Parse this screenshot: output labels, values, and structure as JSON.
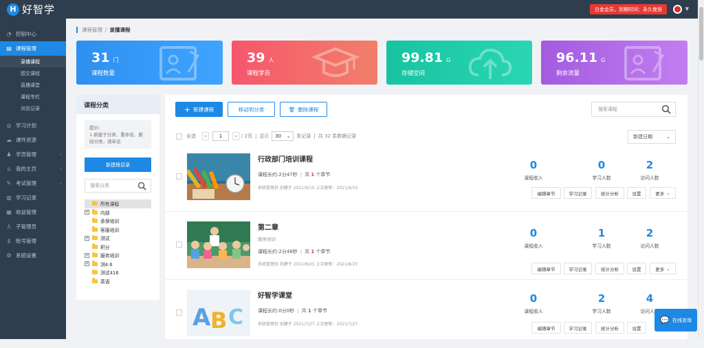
{
  "app": {
    "logo_letter": "H",
    "name": "好智学"
  },
  "topbar": {
    "membership": "白金会员，到期时间：永久使用"
  },
  "sidebar": {
    "items": [
      {
        "label": "控制中心",
        "icon": "dashboard-icon"
      },
      {
        "label": "课程管理",
        "icon": "course-icon",
        "active": true
      },
      {
        "label": "学习计划",
        "icon": "plan-icon"
      },
      {
        "label": "课件资源",
        "icon": "resource-icon"
      },
      {
        "label": "学员管理",
        "icon": "student-icon"
      },
      {
        "label": "我的主页",
        "icon": "home-icon"
      },
      {
        "label": "考试管理",
        "icon": "exam-icon"
      },
      {
        "label": "学习记录",
        "icon": "record-icon"
      },
      {
        "label": "收益管理",
        "icon": "income-icon"
      },
      {
        "label": "子管理员",
        "icon": "admin-icon"
      },
      {
        "label": "账号管理",
        "icon": "account-icon"
      },
      {
        "label": "系统设置",
        "icon": "settings-icon"
      }
    ],
    "sub_items": [
      "录播课程",
      "图文课程",
      "直播课堂",
      "课程专栏",
      "浏览记录"
    ]
  },
  "breadcrumb": {
    "parent": "课程管理",
    "separator": "/",
    "current": "录播课程"
  },
  "stats": [
    {
      "value": "31",
      "unit": "门",
      "label": "课程数量",
      "color": "#2196f3"
    },
    {
      "value": "39",
      "unit": "人",
      "label": "课程学员",
      "color": "#f5576c"
    },
    {
      "value": "99.81",
      "unit": "G",
      "label": "存储空间",
      "color": "#1ec8a5"
    },
    {
      "value": "96.11",
      "unit": "G",
      "label": "剩余流量",
      "color": "#b067e0"
    }
  ],
  "category": {
    "title": "课程分类",
    "tips_title": "提示：",
    "tips_body": "1.新建子分类、重命名、删除分类，请单击",
    "new_button": "新建根目录",
    "search_placeholder": "搜索分类",
    "tree": [
      {
        "label": "所有课程",
        "selected": true
      },
      {
        "label": "内部",
        "expandable": true
      },
      {
        "label": "承保培训"
      },
      {
        "label": "客服培训"
      },
      {
        "label": "测试",
        "expandable": true
      },
      {
        "label": "积分"
      },
      {
        "label": "服务培训",
        "expandable": true
      },
      {
        "label": "测4.6",
        "expandable": true
      },
      {
        "label": "测试416"
      },
      {
        "label": "英语"
      }
    ]
  },
  "toolbar": {
    "new_course": "新建课程",
    "move_category": "移动到分类",
    "delete_course": "删除课程",
    "search_placeholder": "搜索课程"
  },
  "pager": {
    "select_all": "全选",
    "page": "1",
    "total_pages": "/ 2页",
    "show": "显示",
    "page_size": "30",
    "per_page": "条记录",
    "separator": "|",
    "total": "共 32 条数据记录",
    "prev": "<",
    "next": ">",
    "sort": "新建日期"
  },
  "labels": {
    "duration": "课程长约:",
    "total_prefix": "共",
    "chapters_suffix": "个章节",
    "income": "课程收入",
    "learners": "学习人数",
    "visitors": "访问人数",
    "edit": "编辑章节",
    "records": "学习记录",
    "analysis": "统计分析",
    "settings": "设置",
    "more": "更多"
  },
  "courses": [
    {
      "title": "行政部门培训课程",
      "subtitle": "",
      "duration": "2分47秒",
      "chapters": "1",
      "info": "系统管理员 创建于 2021/9/10 上次更新：2021/9/10",
      "income": "0",
      "learners": "0",
      "visitors": "2",
      "thumb_icon": "classroom-pencils-image"
    },
    {
      "title": "第二章",
      "subtitle": "服务培训",
      "duration": "2分48秒",
      "chapters": "1",
      "info": "系统管理员 创建于 2021/8/25 上次更新：2021/8/25",
      "income": "0",
      "learners": "1",
      "visitors": "2",
      "thumb_icon": "classroom-kids-image"
    },
    {
      "title": "好智学课堂",
      "subtitle": "",
      "duration": "0分0秒",
      "chapters": "1",
      "info": "系统管理员 创建于 2021/7/27 上次更新：2021/7/27",
      "income": "0",
      "learners": "2",
      "visitors": "4",
      "thumb_icon": "abc-blocks-image"
    }
  ],
  "chat": {
    "label": "在线咨询"
  }
}
